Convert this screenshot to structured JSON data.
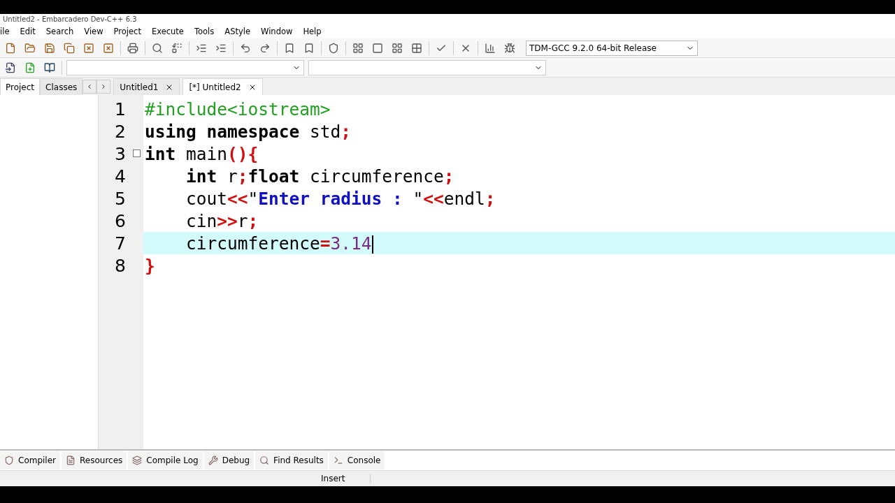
{
  "window": {
    "title": "Untitled2 - Embarcadero Dev-C++ 6.3"
  },
  "menu": [
    "ile",
    "Edit",
    "Search",
    "View",
    "Project",
    "Execute",
    "Tools",
    "AStyle",
    "Window",
    "Help"
  ],
  "compiler_select": {
    "value": "TDM-GCC 9.2.0 64-bit Release"
  },
  "side_tabs": [
    {
      "label": "Project",
      "selected": true
    },
    {
      "label": "Classes",
      "selected": false
    }
  ],
  "editor_tabs": [
    {
      "label": "Untitled1",
      "selected": false
    },
    {
      "label": "[*] Untitled2",
      "selected": true
    }
  ],
  "code_lines": [
    {
      "number": "1",
      "indent": false,
      "fold_marker": false,
      "current": false,
      "tokens": [
        {
          "kind": "pre",
          "text": "#include<iostream>"
        }
      ]
    },
    {
      "number": "2",
      "indent": false,
      "fold_marker": false,
      "current": false,
      "tokens": [
        {
          "kind": "kw",
          "text": "using"
        },
        {
          "kind": "kw",
          "text": " namespace"
        },
        {
          "kind": "plain",
          "text": " std"
        },
        {
          "kind": "sym",
          "text": ";"
        }
      ]
    },
    {
      "number": "3",
      "indent": false,
      "fold_marker": true,
      "current": false,
      "tokens": [
        {
          "kind": "kw",
          "text": "int"
        },
        {
          "kind": "plain",
          "text": " main"
        },
        {
          "kind": "sym",
          "text": "(){"
        }
      ]
    },
    {
      "number": "4",
      "indent": true,
      "fold_marker": false,
      "current": false,
      "tokens": [
        {
          "kind": "kw",
          "text": "int"
        },
        {
          "kind": "plain",
          "text": " r"
        },
        {
          "kind": "sym",
          "text": ";"
        },
        {
          "kind": "kw",
          "text": "float"
        },
        {
          "kind": "plain",
          "text": " circumference"
        },
        {
          "kind": "sym",
          "text": ";"
        }
      ]
    },
    {
      "number": "5",
      "indent": true,
      "fold_marker": false,
      "current": false,
      "tokens": [
        {
          "kind": "plain",
          "text": "cout"
        },
        {
          "kind": "sym",
          "text": "<<"
        },
        {
          "kind": "plain",
          "text": "\""
        },
        {
          "kind": "str",
          "text": "Enter radius :"
        },
        {
          "kind": "plain",
          "text": " \""
        },
        {
          "kind": "sym",
          "text": "<<"
        },
        {
          "kind": "plain",
          "text": "endl"
        },
        {
          "kind": "sym",
          "text": ";"
        }
      ]
    },
    {
      "number": "6",
      "indent": true,
      "fold_marker": false,
      "current": false,
      "tokens": [
        {
          "kind": "plain",
          "text": "cin"
        },
        {
          "kind": "sym",
          "text": ">>"
        },
        {
          "kind": "plain",
          "text": "r"
        },
        {
          "kind": "sym",
          "text": ";"
        }
      ]
    },
    {
      "number": "7",
      "indent": true,
      "fold_marker": false,
      "current": true,
      "tokens": [
        {
          "kind": "plain",
          "text": "circumference"
        },
        {
          "kind": "sym",
          "text": "="
        },
        {
          "kind": "num",
          "text": "3.14"
        }
      ]
    },
    {
      "number": "8",
      "indent": false,
      "fold_marker": false,
      "current": false,
      "tokens": [
        {
          "kind": "sym",
          "text": "}"
        }
      ]
    }
  ],
  "bottom_tabs": [
    "Compiler",
    "Resources",
    "Compile Log",
    "Debug",
    "Find Results",
    "Console"
  ],
  "status_bar": {
    "mode": "Insert"
  }
}
